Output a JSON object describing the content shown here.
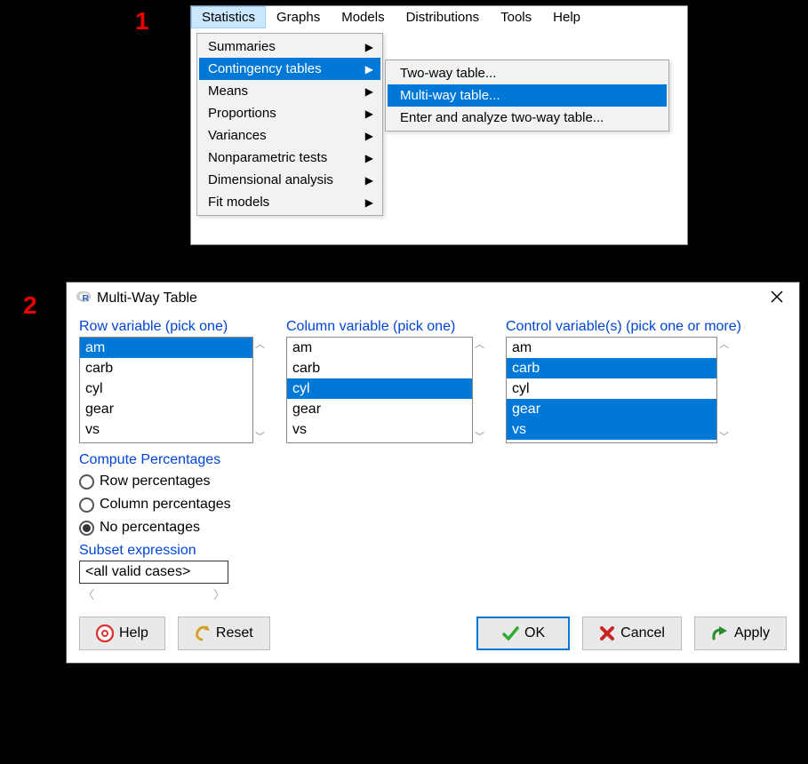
{
  "steps": {
    "one": "1",
    "two": "2"
  },
  "menubar": {
    "items": [
      "Statistics",
      "Graphs",
      "Models",
      "Distributions",
      "Tools",
      "Help"
    ],
    "open_index": 0
  },
  "dropdown": {
    "items": [
      {
        "label": "Summaries",
        "has_sub": true
      },
      {
        "label": "Contingency tables",
        "has_sub": true,
        "highlight": true
      },
      {
        "label": "Means",
        "has_sub": true
      },
      {
        "label": "Proportions",
        "has_sub": true
      },
      {
        "label": "Variances",
        "has_sub": true
      },
      {
        "label": "Nonparametric tests",
        "has_sub": true
      },
      {
        "label": "Dimensional analysis",
        "has_sub": true
      },
      {
        "label": "Fit models",
        "has_sub": true
      }
    ]
  },
  "submenu": {
    "items": [
      {
        "label": "Two-way table..."
      },
      {
        "label": "Multi-way table...",
        "highlight": true
      },
      {
        "label": "Enter and analyze two-way table..."
      }
    ]
  },
  "dialog": {
    "title": "Multi-Way Table",
    "row_var": {
      "label": "Row variable (pick one)",
      "items": [
        {
          "label": "am",
          "selected": true
        },
        {
          "label": "carb"
        },
        {
          "label": "cyl"
        },
        {
          "label": "gear"
        },
        {
          "label": "vs"
        }
      ]
    },
    "col_var": {
      "label": "Column variable (pick one)",
      "items": [
        {
          "label": "am"
        },
        {
          "label": "carb"
        },
        {
          "label": "cyl",
          "selected": true
        },
        {
          "label": "gear"
        },
        {
          "label": "vs"
        }
      ]
    },
    "ctrl_var": {
      "label": "Control variable(s) (pick one or more)",
      "items": [
        {
          "label": "am"
        },
        {
          "label": "carb",
          "selected": true
        },
        {
          "label": "cyl"
        },
        {
          "label": "gear",
          "selected": true
        },
        {
          "label": "vs",
          "selected": true
        }
      ]
    },
    "percentages": {
      "label": "Compute Percentages",
      "options": [
        {
          "label": "Row percentages",
          "checked": false
        },
        {
          "label": "Column percentages",
          "checked": false
        },
        {
          "label": "No percentages",
          "checked": true
        }
      ]
    },
    "subset": {
      "label": "Subset expression",
      "value": "<all valid cases>"
    },
    "buttons": {
      "help": "Help",
      "reset": "Reset",
      "ok": "OK",
      "cancel": "Cancel",
      "apply": "Apply"
    }
  }
}
